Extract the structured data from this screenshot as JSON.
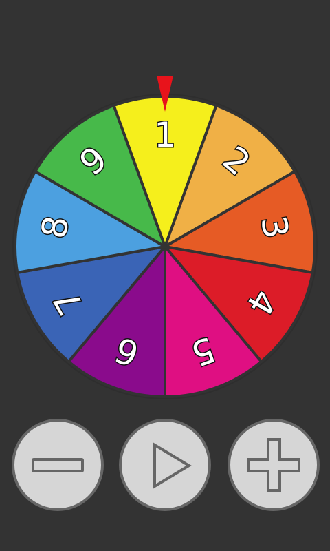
{
  "wheel": {
    "segments": [
      {
        "label": "1",
        "color": "#f5ef1c"
      },
      {
        "label": "2",
        "color": "#f0b046"
      },
      {
        "label": "3",
        "color": "#e65b25"
      },
      {
        "label": "4",
        "color": "#dc1c28"
      },
      {
        "label": "5",
        "color": "#df0f82"
      },
      {
        "label": "6",
        "color": "#8a0b8c"
      },
      {
        "label": "7",
        "color": "#3a64b6"
      },
      {
        "label": "8",
        "color": "#4ca0e0"
      },
      {
        "label": "9",
        "color": "#47b94a"
      }
    ],
    "pointer_color": "#e8131b",
    "divider_color": "#333333"
  },
  "controls": {
    "minus_icon": "minus-icon",
    "play_icon": "play-icon",
    "plus_icon": "plus-icon"
  },
  "colors": {
    "background": "#333333",
    "button_fill": "#d6d6d6",
    "button_border": "#666666"
  }
}
